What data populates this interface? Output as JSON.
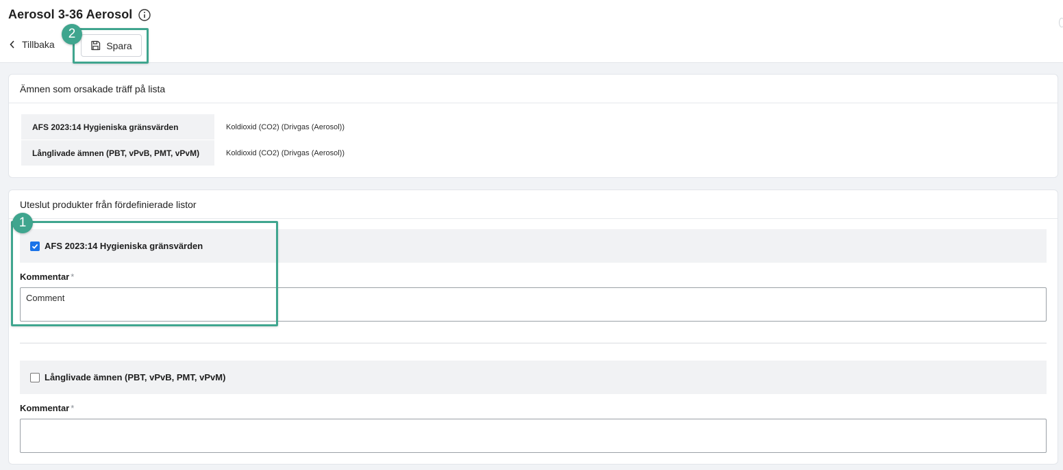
{
  "header": {
    "title": "Aerosol 3-36 Aerosol",
    "back_label": "Tillbaka",
    "save_label": "Spara"
  },
  "hits_card": {
    "title": "Ämnen som orsakade träff på lista",
    "rows": [
      {
        "list": "AFS 2023:14 Hygieniska gränsvärden",
        "substance": "Koldioxid (CO2) (Drivgas (Aerosol))"
      },
      {
        "list": "Långlivade ämnen (PBT, vPvB, PMT, vPvM)",
        "substance": "Koldioxid (CO2) (Drivgas (Aerosol))"
      }
    ]
  },
  "exclude_card": {
    "title": "Uteslut produkter från fördefinierade listor",
    "lists": [
      {
        "label": "AFS 2023:14 Hygieniska gränsvärden",
        "checked": true,
        "comment_label": "Kommentar",
        "required_mark": "*",
        "comment_value": "Comment"
      },
      {
        "label": "Långlivade ämnen (PBT, vPvB, PMT, vPvM)",
        "checked": false,
        "comment_label": "Kommentar",
        "required_mark": "*",
        "comment_value": ""
      }
    ]
  },
  "annotations": {
    "badge_1": "1",
    "badge_2": "2"
  },
  "colors": {
    "callout": "#3fa58e",
    "checkbox_checked": "#1a73e8"
  },
  "icons": {
    "info": "info-icon",
    "back": "chevron-left-icon",
    "save": "floppy-disk-icon"
  }
}
